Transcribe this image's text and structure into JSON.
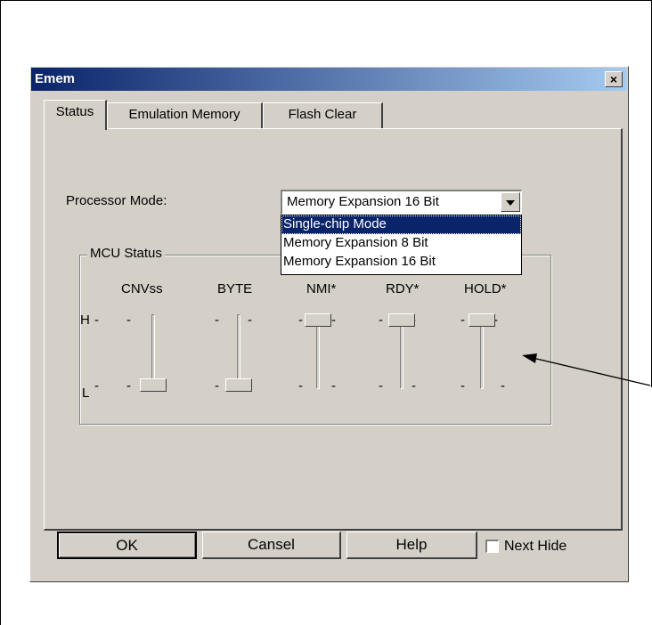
{
  "window": {
    "title": "Emem",
    "close_glyph": "×"
  },
  "tabs": [
    {
      "label": "Status",
      "active": true
    },
    {
      "label": "Emulation Memory",
      "active": false
    },
    {
      "label": "Flash Clear",
      "active": false
    }
  ],
  "processor_mode": {
    "label": "Processor Mode:",
    "value": "Memory Expansion 16 Bit",
    "options": [
      "Single-chip Mode",
      "Memory Expansion 8 Bit",
      "Memory Expansion 16 Bit"
    ],
    "highlighted_option": "Single-chip Mode"
  },
  "mcu_status": {
    "title": "MCU Status",
    "tick_high": "H",
    "tick_low": "L",
    "sliders": [
      {
        "name": "CNVss",
        "level": "L"
      },
      {
        "name": "BYTE",
        "level": "L"
      },
      {
        "name": "NMI*",
        "level": "H"
      },
      {
        "name": "RDY*",
        "level": "H"
      },
      {
        "name": "HOLD*",
        "level": "H"
      }
    ]
  },
  "buttons": {
    "ok": "OK",
    "cancel": "Cansel",
    "help": "Help"
  },
  "next_hide": {
    "label": "Next Hide",
    "checked": false
  },
  "colors": {
    "dialog_bg": "#d4d0c8",
    "title_start": "#0a246a",
    "title_end": "#a6caf0",
    "selection": "#0a246a"
  }
}
